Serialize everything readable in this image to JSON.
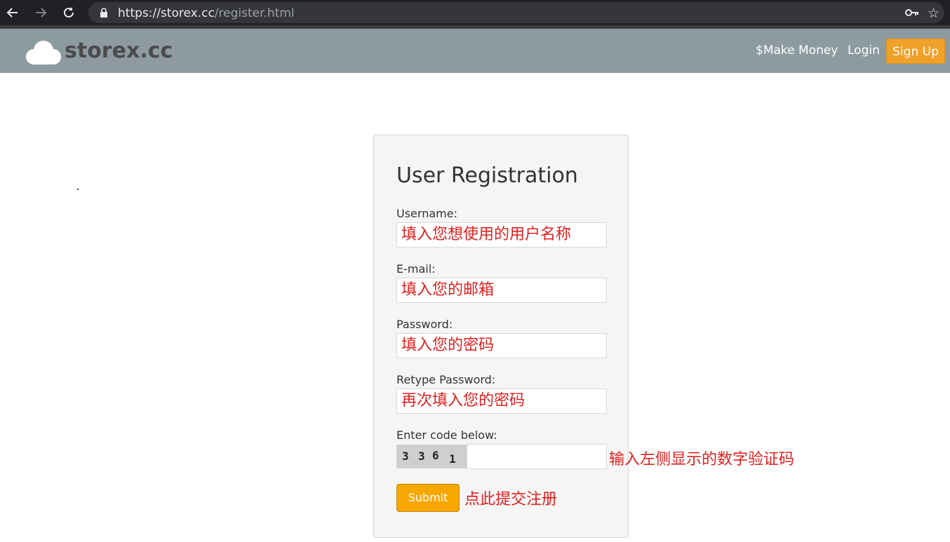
{
  "browser": {
    "url_host": "https://storex.cc",
    "url_path": "/register.html"
  },
  "header": {
    "logo_text": "storex.cc",
    "nav": {
      "make_money": "$Make Money",
      "login": "Login",
      "signup": "Sign Up"
    }
  },
  "form": {
    "title": "User Registration",
    "username": {
      "label": "Username:",
      "value": "填入您想使用的用户名称"
    },
    "email": {
      "label": "E-mail:",
      "value": "填入您的邮箱"
    },
    "password": {
      "label": "Password:",
      "value": "填入您的密码"
    },
    "retype": {
      "label": "Retype Password:",
      "value": "再次填入您的密码"
    },
    "code": {
      "label": "Enter code below:",
      "digits": [
        "3",
        "3",
        "6",
        "1"
      ],
      "note": "输入左侧显示的数字验证码"
    },
    "submit": {
      "label": "Submit",
      "note": "点此提交注册"
    }
  },
  "colors": {
    "header_bg": "#8d9ba1",
    "signup_bg": "#f0a12a",
    "submit_bg": "#f7a800",
    "annotation": "#e02020"
  },
  "icons": [
    "back-arrow-icon",
    "forward-arrow-icon",
    "reload-icon",
    "lock-icon",
    "key-icon",
    "star-icon",
    "cloud-logo-icon"
  ]
}
